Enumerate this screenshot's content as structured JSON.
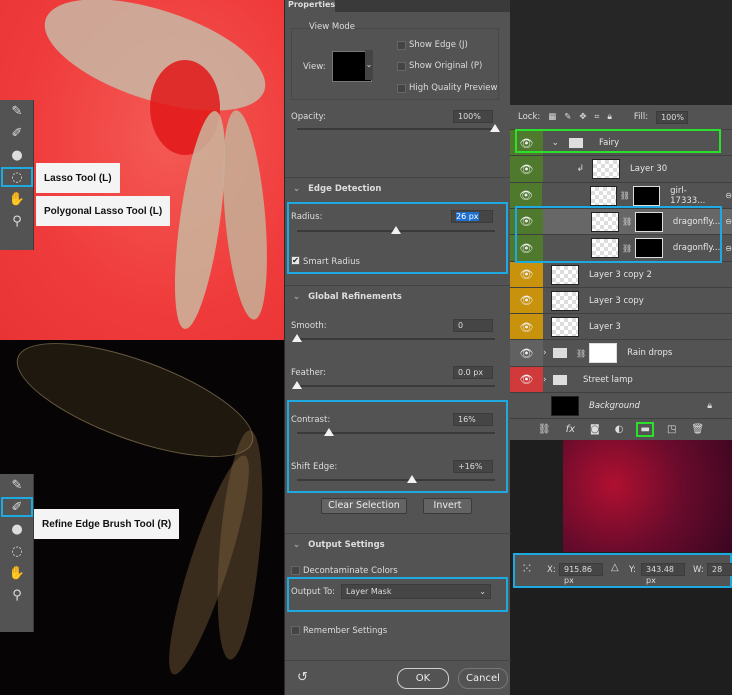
{
  "tooltips": {
    "lasso": "Lasso Tool (L)",
    "polygonal_lasso": "Polygonal Lasso Tool (L)",
    "refine_edge_brush": "Refine Edge Brush Tool (R)"
  },
  "properties": {
    "tab": "Properties",
    "view_mode": {
      "title": "View Mode",
      "view_label": "View:",
      "show_edge": "Show Edge (J)",
      "show_original": "Show Original (P)",
      "high_quality": "High Quality Preview"
    },
    "opacity": {
      "label": "Opacity:",
      "value": "100%",
      "level": 100
    },
    "edge_detection": {
      "title": "Edge Detection",
      "radius_label": "Radius:",
      "radius_value": "26 px",
      "radius_level": 50,
      "smart_radius": "Smart Radius",
      "smart_radius_checked": true
    },
    "global": {
      "title": "Global Refinements",
      "smooth_label": "Smooth:",
      "smooth_value": "0",
      "feather_label": "Feather:",
      "feather_value": "0.0 px",
      "contrast_label": "Contrast:",
      "contrast_value": "16%",
      "contrast_level": 16,
      "shift_label": "Shift Edge:",
      "shift_value": "+16%",
      "shift_level": 58
    },
    "clear_selection": "Clear Selection",
    "invert": "Invert",
    "output": {
      "title": "Output Settings",
      "decontaminate": "Decontaminate Colors",
      "output_to_label": "Output To:",
      "output_to_value": "Layer Mask"
    },
    "remember": "Remember Settings",
    "ok": "OK",
    "cancel": "Cancel"
  },
  "layers": {
    "lock_label": "Lock:",
    "fill_label": "Fill:",
    "fill_value": "100%",
    "items": [
      {
        "name": "Fairy",
        "color": "#4f7a2e"
      },
      {
        "name": "Layer 30",
        "color": "#4f7a2e"
      },
      {
        "name": "girl-17333...",
        "color": "#4f7a2e"
      },
      {
        "name": "dragonfly...",
        "color": "#4f7a2e"
      },
      {
        "name": "dragonfly...",
        "color": "#4f7a2e"
      },
      {
        "name": "Layer 3 copy 2",
        "color": "#c9920c"
      },
      {
        "name": "Layer 3 copy",
        "color": "#c9920c"
      },
      {
        "name": "Layer 3",
        "color": "#c9920c"
      },
      {
        "name": "Rain drops",
        "color": "#616161"
      },
      {
        "name": "Street lamp",
        "color": "#d03a3a"
      },
      {
        "name": "Background",
        "color": "#535353"
      }
    ]
  },
  "options": {
    "x_label": "X:",
    "x_value": "915.86 px",
    "y_label": "Y:",
    "y_value": "343.48 px",
    "w_label": "W:",
    "w_value": "28"
  },
  "colors": {
    "highlight_blue": "#1ea9e0",
    "highlight_green": "#2be02b",
    "panel": "#535353"
  }
}
